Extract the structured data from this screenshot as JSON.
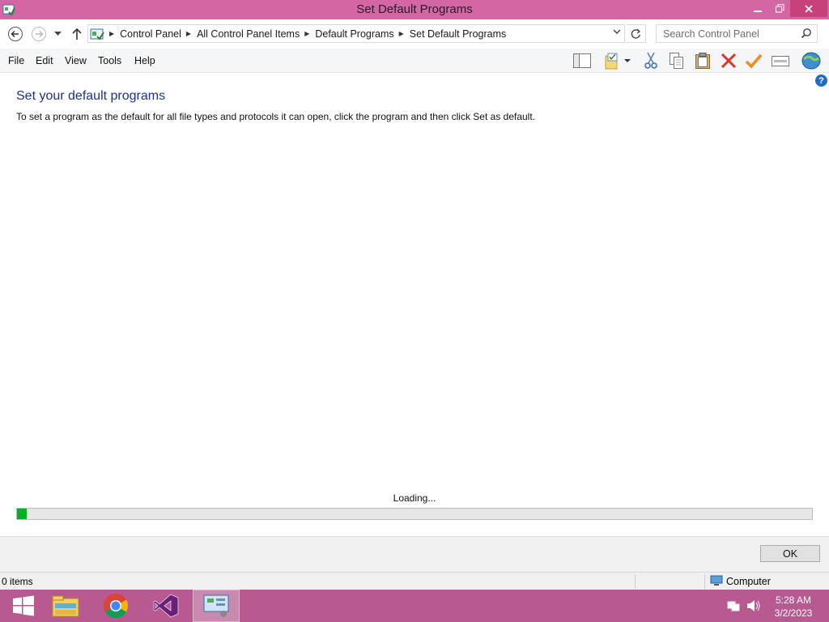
{
  "window": {
    "title": "Set Default Programs",
    "controls": [
      "minimize",
      "restore",
      "close"
    ]
  },
  "address_bar": {
    "breadcrumbs": [
      "Control Panel",
      "All Control Panel Items",
      "Default Programs",
      "Set Default Programs"
    ],
    "search_placeholder": "Search Control Panel"
  },
  "menu": {
    "file": "File",
    "edit": "Edit",
    "view": "View",
    "tools": "Tools",
    "help": "Help"
  },
  "toolbar": {
    "icons": [
      "layout-pane-icon",
      "folder-options-icon",
      "cut-icon",
      "copy-icon",
      "paste-icon",
      "delete-icon",
      "checkmark-icon",
      "properties-icon",
      "globe-icon"
    ]
  },
  "main": {
    "heading": "Set your default programs",
    "description": "To set a program as the default for all file types and protocols it can open, click the program and then click Set as default.",
    "loading_text": "Loading...",
    "progress": 0.012
  },
  "buttons": {
    "ok": "OK"
  },
  "status": {
    "items": "0 items",
    "zone": "Computer"
  },
  "taskbar": {
    "apps": [
      "windows-start-icon",
      "file-explorer-icon",
      "chrome-icon",
      "visual-studio-icon",
      "control-panel-icon"
    ],
    "time": "5:28 AM",
    "date": "3/2/2023"
  },
  "colors": {
    "titlebar": "#d566a5",
    "taskbar": "#b85a91",
    "heading": "#1e3287",
    "progress_fill": "#06b025"
  }
}
